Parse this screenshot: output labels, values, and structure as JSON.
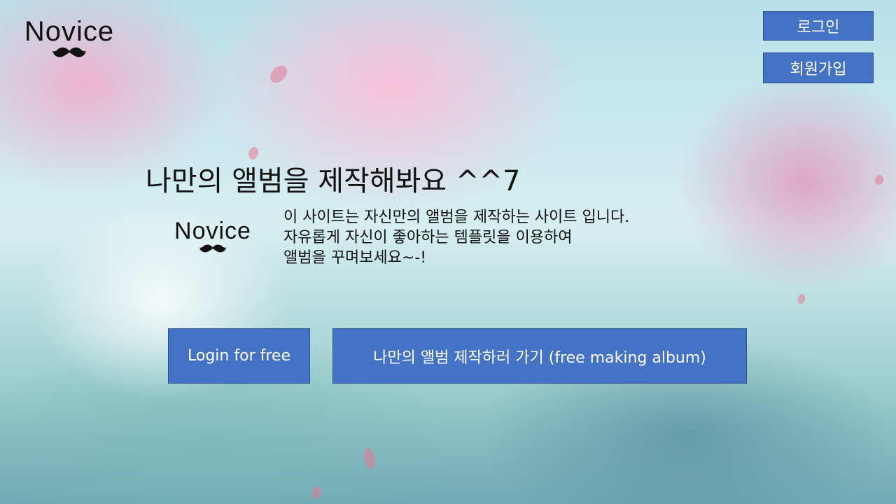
{
  "brand": {
    "logo_text": "Novice",
    "mark_icon": "mustache-icon"
  },
  "header": {
    "login_label": "로그인",
    "signup_label": "회원가입"
  },
  "hero": {
    "headline": "나만의 앨범을 제작해봐요 ^^7",
    "logo_text": "Novice",
    "description_lines": [
      "이 사이트는 자신만의 앨범을 제작하는 사이트 입니다.",
      "자유롭게 자신이 좋아하는 템플릿을 이용하여",
      "앨범을 꾸며보세요~-!"
    ]
  },
  "actions": {
    "login_free_label": "Login for free",
    "make_album_label": "나만의 앨범 제작하러 가기 (free making album)"
  },
  "colors": {
    "button_bg": "#4472c4",
    "button_border": "#2f528f"
  }
}
